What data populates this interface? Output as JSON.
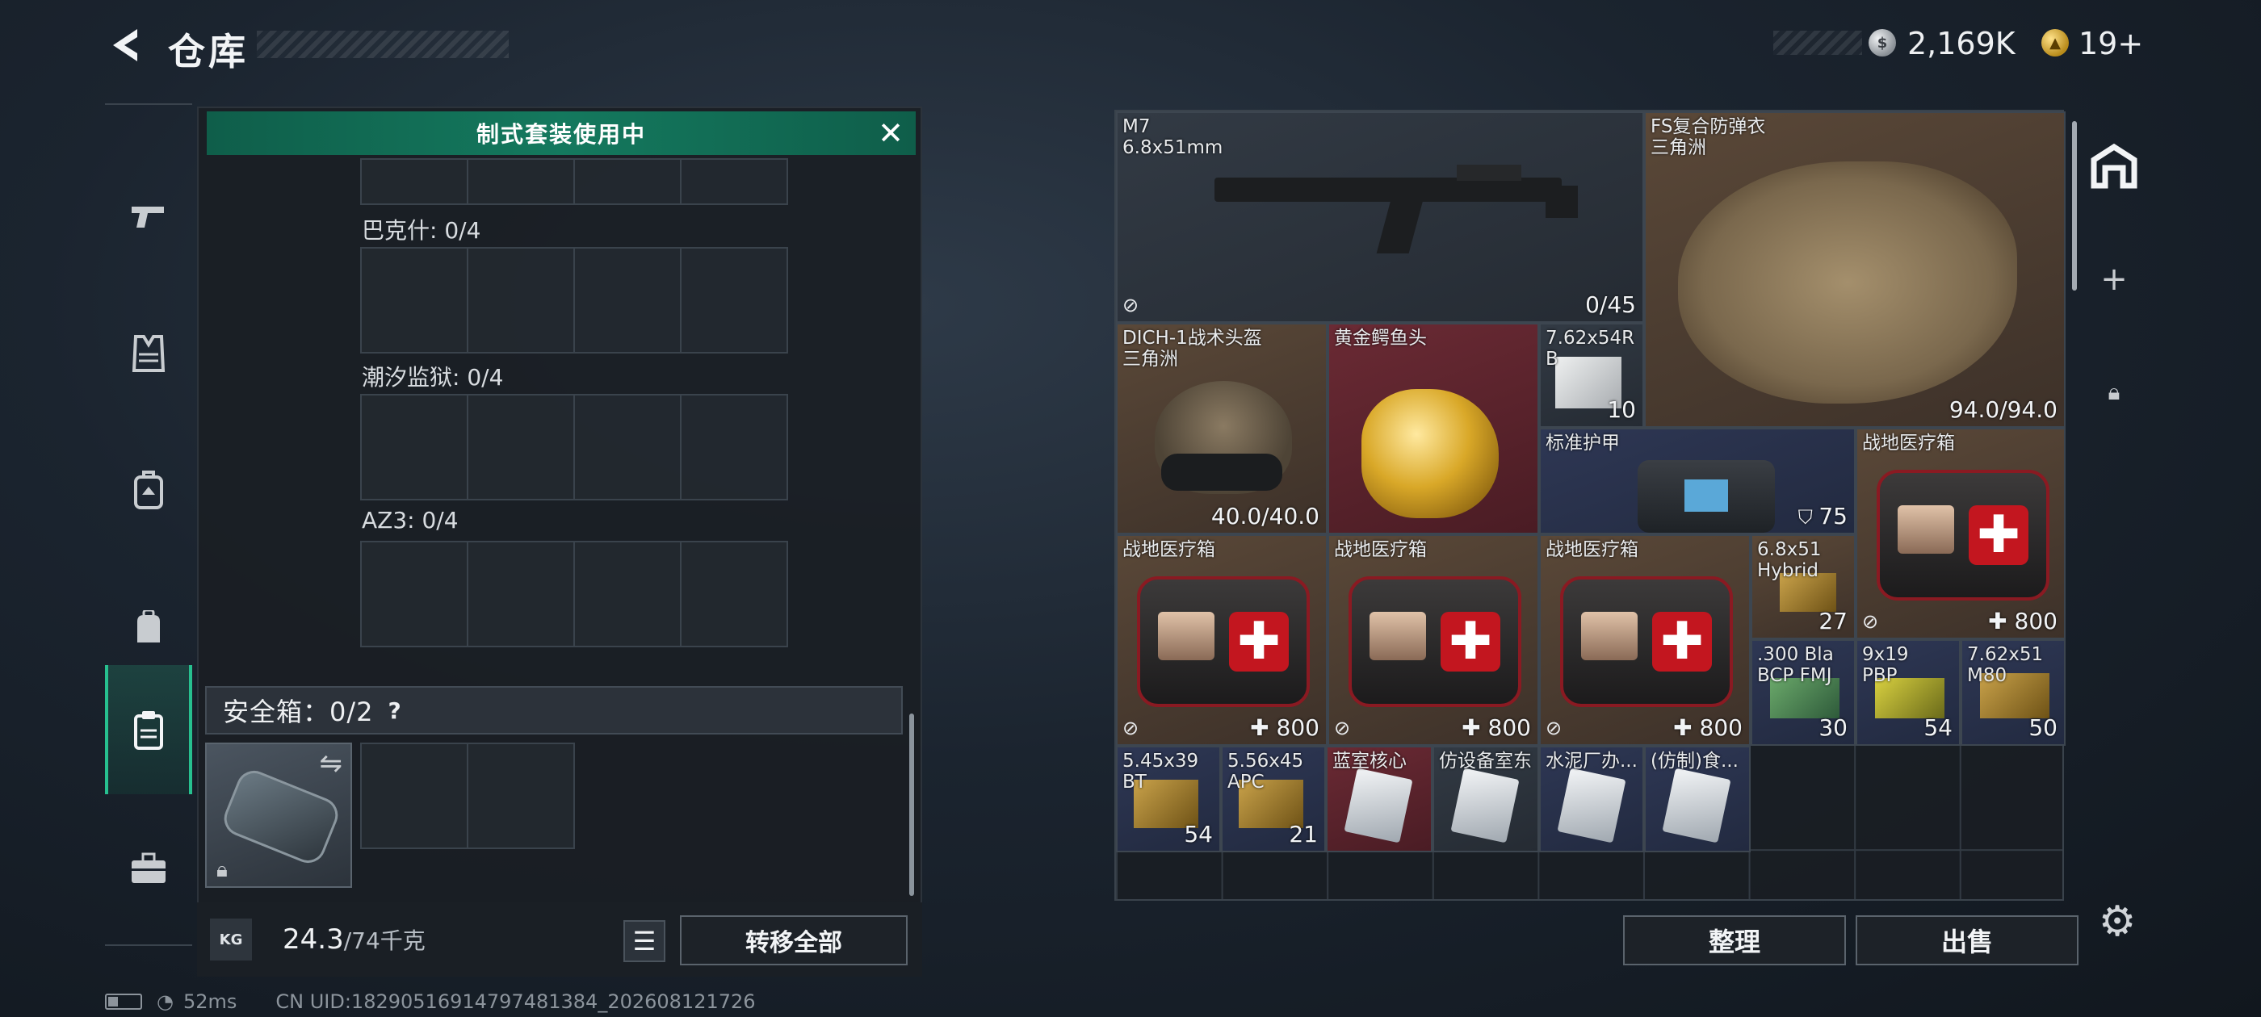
{
  "header": {
    "title": "仓库",
    "currency": {
      "silver": "2,169K",
      "gold": "19+"
    }
  },
  "sidebar": {
    "tabs": [
      {
        "name": "weapons",
        "icon": "pistol-icon"
      },
      {
        "name": "armor",
        "icon": "vest-icon"
      },
      {
        "name": "chest-rig",
        "icon": "chest-rig-icon"
      },
      {
        "name": "backpack",
        "icon": "backpack-icon"
      },
      {
        "name": "safebox",
        "icon": "clipboard-icon",
        "active": true
      },
      {
        "name": "toolbox",
        "icon": "briefcase-icon"
      }
    ]
  },
  "loadout": {
    "banner": "制式套装使用中",
    "groups": [
      {
        "label": "巴克什: 0/4"
      },
      {
        "label": "潮汐监狱: 0/4"
      },
      {
        "label": "AZ3: 0/4"
      }
    ],
    "safebox": {
      "label": "安全箱：0/2",
      "help": "?"
    },
    "weight": {
      "current": "24.3",
      "max": "/74千克"
    },
    "transfer_all": "转移全部",
    "kg_icon": "KG"
  },
  "stash": {
    "items": [
      {
        "id": "m7",
        "name": "M7\n6.8x51mm",
        "qty": "0/45"
      },
      {
        "id": "fs-vest",
        "name": "FS复合防弹衣\n三角洲",
        "qty": "94.0/94.0"
      },
      {
        "id": "dich-helmet",
        "name": "DICH-1战术头盔\n三角洲",
        "qty": "40.0/40.0"
      },
      {
        "id": "gold-croc",
        "name": "黄金鳄鱼头",
        "qty": ""
      },
      {
        "id": "ammo-762x54",
        "name": "7.62x54R\nB",
        "qty": "10"
      },
      {
        "id": "std-armor",
        "name": "标准护甲",
        "qty": "75"
      },
      {
        "id": "medkit-1",
        "name": "战地医疗箱",
        "qty": "800"
      },
      {
        "id": "medkit-2",
        "name": "战地医疗箱",
        "qty": "800"
      },
      {
        "id": "medkit-3",
        "name": "战地医疗箱",
        "qty": "800"
      },
      {
        "id": "medkit-4",
        "name": "战地医疗箱",
        "qty": "800"
      },
      {
        "id": "ammo-68x51",
        "name": "6.8x51\nHybrid",
        "qty": "27"
      },
      {
        "id": "medkit-5",
        "name": "战地医疗箱",
        "qty": "800"
      },
      {
        "id": "ammo-300blk",
        "name": ".300 Bla\nBCP FMJ",
        "qty": "30"
      },
      {
        "id": "ammo-9x19",
        "name": "9x19\nPBP",
        "qty": "54"
      },
      {
        "id": "ammo-762x51",
        "name": "7.62x51\nM80",
        "qty": "50"
      },
      {
        "id": "ammo-545x39",
        "name": "5.45x39\nBT",
        "qty": "54"
      },
      {
        "id": "ammo-556x45",
        "name": "5.56x45\nAPC",
        "qty": "21"
      },
      {
        "id": "blue-core",
        "name": "蓝室核心",
        "qty": ""
      },
      {
        "id": "device-key",
        "name": "仿设备室东",
        "qty": ""
      },
      {
        "id": "cement-key",
        "name": "水泥厂办...",
        "qty": ""
      },
      {
        "id": "fake-food",
        "name": "(仿制)食...",
        "qty": ""
      }
    ],
    "sort": "整理",
    "sell": "出售"
  },
  "status": {
    "ping": "52ms",
    "uid": "CN UID:18290516914797481384_202608121726"
  },
  "colors": {
    "banner": "#14795e",
    "active_tab": "#27c08f",
    "bg_red": "#6a2a34",
    "bg_brown": "#5a4838",
    "bg_blue": "#2e3754"
  }
}
